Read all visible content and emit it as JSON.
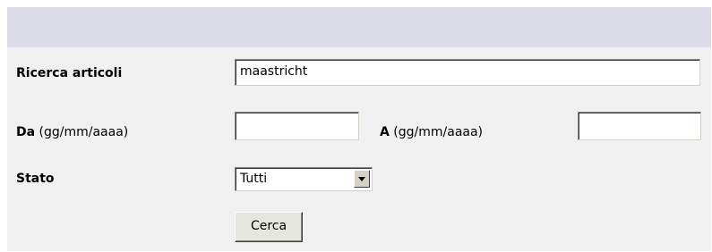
{
  "form": {
    "search_label": "Ricerca articoli",
    "search_value": "maastricht",
    "from_label_bold": "Da",
    "from_label_hint": "(gg/mm/aaaa)",
    "from_value": "",
    "to_label_bold": "A",
    "to_label_hint": "(gg/mm/aaaa)",
    "to_value": "",
    "status_label": "Stato",
    "status_selected": "Tutti",
    "submit_label": "Cerca"
  }
}
